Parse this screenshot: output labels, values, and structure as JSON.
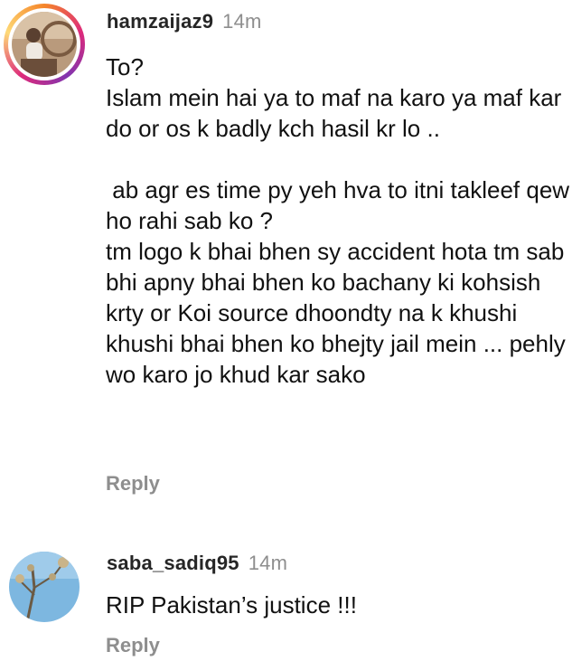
{
  "comments": [
    {
      "username": "hamzaijaz9",
      "time": "14m",
      "text": "To?\nIslam mein hai ya to maf na karo ya maf kar do or os k badly kch hasil kr lo ..\n\n ab agr es time py yeh hva to itni takleef qew ho rahi sab ko ?\ntm logo k bhai bhen sy accident hota tm sab bhi apny bhai bhen ko bachany ki kohsish krty or Koi source dhoondty na k khushi khushi bhai bhen ko bhejty jail mein ... pehly wo karo jo khud kar sako",
      "reply_label": "Reply",
      "avatar_icon": "user-avatar-story-ring"
    },
    {
      "username": "saba_sadiq95",
      "time": "14m",
      "text": "RIP Pakistan’s justice !!!",
      "reply_label": "Reply",
      "avatar_icon": "user-avatar-tree-sky"
    }
  ],
  "colors": {
    "username": "#262626",
    "meta_gray": "#8e8e8e",
    "text": "#111111",
    "story_ring_gradient": [
      "#f58529",
      "#dd2a7b",
      "#8134af",
      "#feda77"
    ]
  }
}
